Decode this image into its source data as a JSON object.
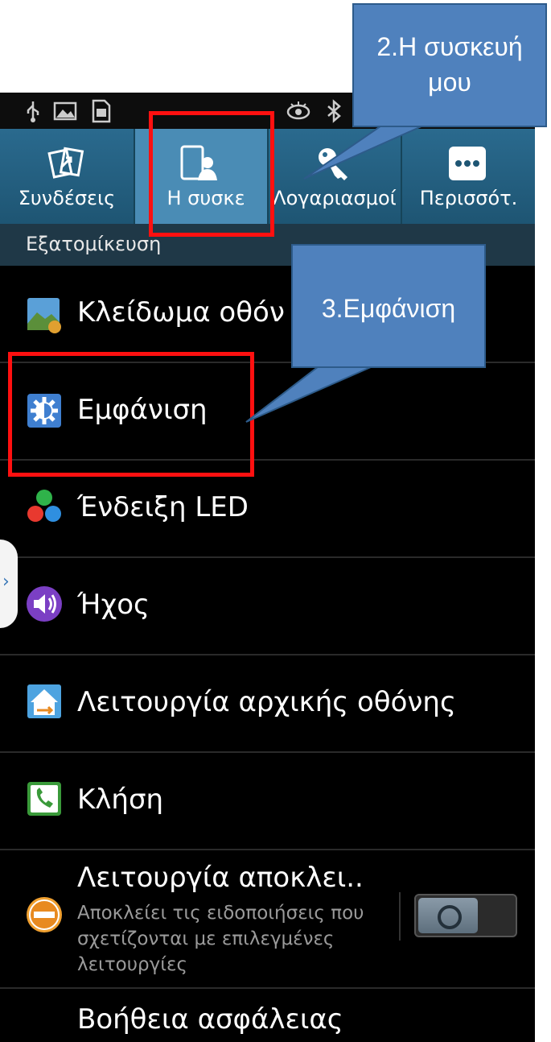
{
  "tabs": [
    {
      "label": "Συνδέσεις",
      "icon": "connections-icon"
    },
    {
      "label": "Η συσκε",
      "icon": "my-device-icon"
    },
    {
      "label": "Λογαριασμοί",
      "icon": "accounts-key-icon"
    },
    {
      "label": "Περισσότ.",
      "icon": "more-dots-icon"
    }
  ],
  "section": {
    "title": "Εξατομίκευση"
  },
  "rows": [
    {
      "title": "Κλείδωμα οθόν",
      "icon": "lock-screen-icon"
    },
    {
      "title": "Εμφάνιση",
      "icon": "display-gear-icon"
    },
    {
      "title": "Ένδειξη LED",
      "icon": "led-indicator-icon"
    },
    {
      "title": "Ήχος",
      "icon": "sound-icon"
    },
    {
      "title": "Λειτουργία αρχικής οθόνης",
      "icon": "home-screen-mode-icon"
    },
    {
      "title": "Κλήση",
      "icon": "call-icon"
    },
    {
      "title": "Λειτουργία αποκλει..",
      "subtitle": "Αποκλείει τις ειδοποιήσεις που σχετίζονται με επιλεγμένες λειτουργίες",
      "icon": "block-mode-icon",
      "toggle": "off"
    },
    {
      "title": "Βοήθεια ασφάλειας",
      "icon": ""
    }
  ],
  "callouts": {
    "step2_line1": "2.Η συσκευή",
    "step2_line2": "μου",
    "step3": "3.Εμφάνιση"
  },
  "colors": {
    "callout": "#4f81bd",
    "highlight": "#ff1010",
    "tab_bar": "#2a6a8e"
  }
}
